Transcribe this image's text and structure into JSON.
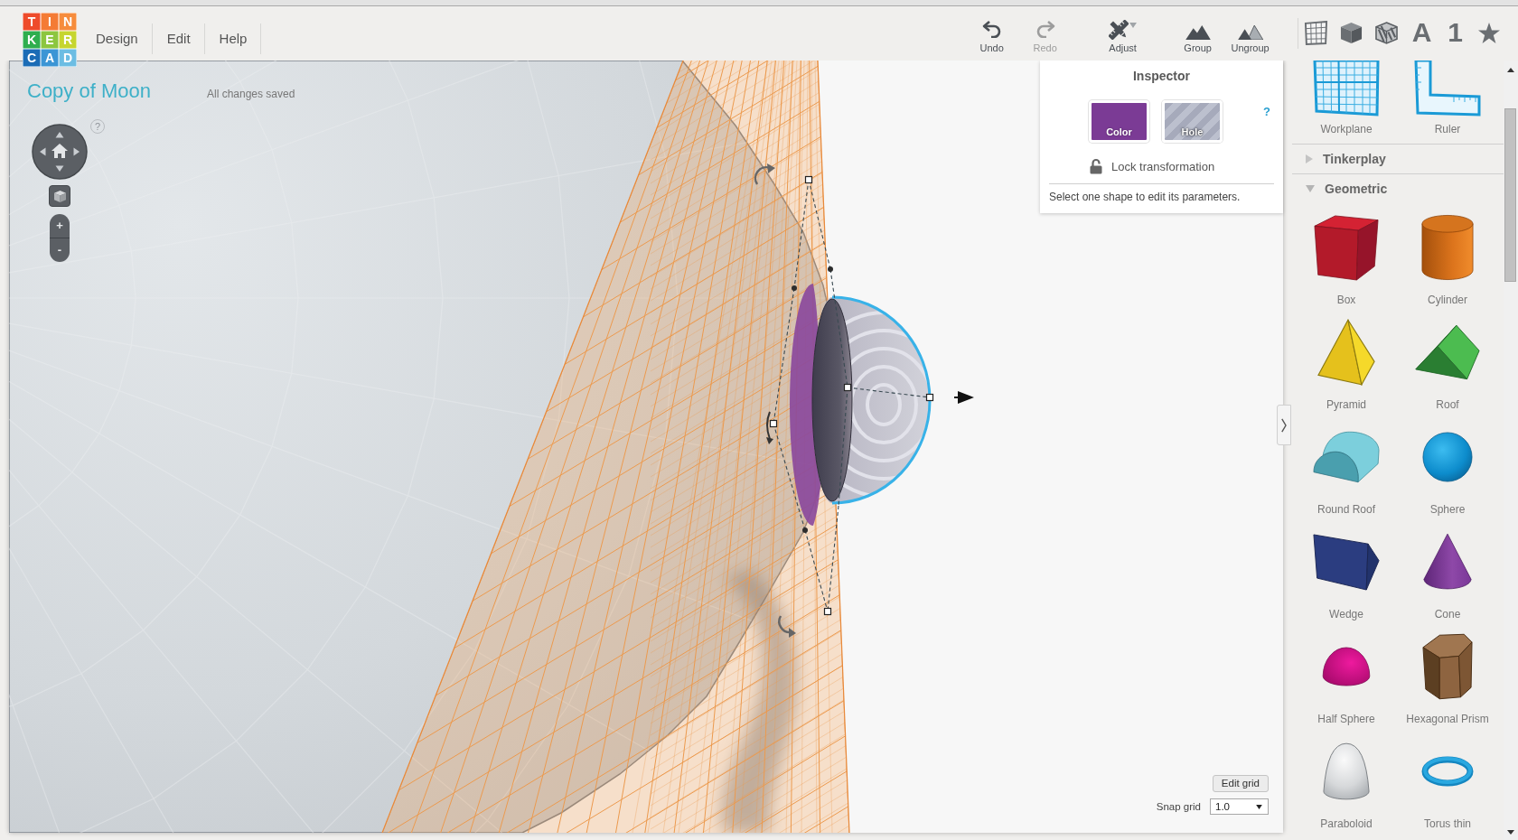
{
  "logo": {
    "tiles": [
      {
        "letter": "T",
        "color": "#ee4b2b"
      },
      {
        "letter": "I",
        "color": "#f47b35"
      },
      {
        "letter": "N",
        "color": "#f68c3c"
      },
      {
        "letter": "K",
        "color": "#2fae4e"
      },
      {
        "letter": "E",
        "color": "#8cc63f"
      },
      {
        "letter": "R",
        "color": "#c6d52f"
      },
      {
        "letter": "C",
        "color": "#1b6cb6"
      },
      {
        "letter": "A",
        "color": "#3b95d5"
      },
      {
        "letter": "D",
        "color": "#6cbde3"
      }
    ]
  },
  "menu": [
    "Design",
    "Edit",
    "Help"
  ],
  "toolbar": [
    {
      "kind": "undo",
      "label": "Undo",
      "disabled": false
    },
    {
      "kind": "redo",
      "label": "Redo",
      "disabled": true
    },
    {
      "kind": "adjust",
      "label": "Adjust",
      "disabled": false
    },
    {
      "kind": "group",
      "label": "Group",
      "disabled": false
    },
    {
      "kind": "ungroup",
      "label": "Ungroup",
      "disabled": false
    }
  ],
  "shape_categories": [
    {
      "kind": "workplane"
    },
    {
      "kind": "solid"
    },
    {
      "kind": "hole"
    },
    {
      "kind": "glyph",
      "glyph": "A"
    },
    {
      "kind": "glyph",
      "glyph": "1"
    },
    {
      "kind": "favorite"
    }
  ],
  "design": {
    "title": "Copy of Moon",
    "save_status": "All changes saved"
  },
  "view_controls": {
    "help": "?",
    "zoom_in": "+",
    "zoom_out": "-"
  },
  "inspector": {
    "title": "Inspector",
    "swatches": [
      {
        "kind": "color",
        "label": "Color",
        "color": "#7b3b95"
      },
      {
        "kind": "hole",
        "label": "Hole"
      }
    ],
    "help": "?",
    "lock": {
      "label": "Lock transformation",
      "locked": false
    },
    "note": "Select one shape to edit its parameters."
  },
  "grid_controls": {
    "edit_button": "Edit grid",
    "snap_label": "Snap grid",
    "snap_value": "1.0"
  },
  "library": {
    "helpers": [
      {
        "kind": "workplane",
        "label": "Workplane"
      },
      {
        "kind": "ruler",
        "label": "Ruler"
      }
    ],
    "sections": [
      {
        "title": "Tinkerplay",
        "expanded": false
      },
      {
        "title": "Geometric",
        "expanded": true,
        "shapes": [
          {
            "kind": "box",
            "label": "Box"
          },
          {
            "kind": "cylinder",
            "label": "Cylinder"
          },
          {
            "kind": "pyramid",
            "label": "Pyramid"
          },
          {
            "kind": "roof",
            "label": "Roof"
          },
          {
            "kind": "roundroof",
            "label": "Round Roof"
          },
          {
            "kind": "sphere",
            "label": "Sphere"
          },
          {
            "kind": "wedge",
            "label": "Wedge"
          },
          {
            "kind": "cone",
            "label": "Cone"
          },
          {
            "kind": "halfsphere",
            "label": "Half Sphere"
          },
          {
            "kind": "hexprism",
            "label": "Hexagonal Prism"
          },
          {
            "kind": "paraboloid",
            "label": "Paraboloid"
          },
          {
            "kind": "torus",
            "label": "Torus thin"
          }
        ]
      }
    ]
  }
}
